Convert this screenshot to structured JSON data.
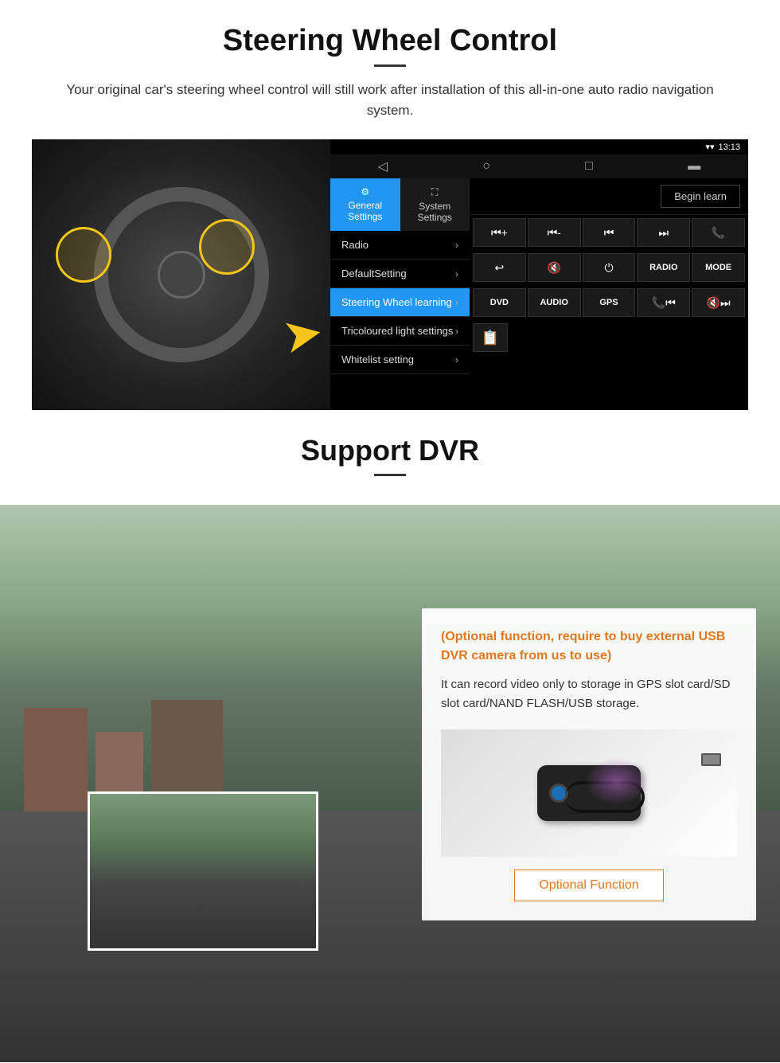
{
  "steering": {
    "title": "Steering Wheel Control",
    "subtitle": "Your original car's steering wheel control will still work after installation of this all-in-one auto radio navigation system.",
    "statusbar": {
      "time": "13:13",
      "signal_icon": "▾",
      "wifi_icon": "▾"
    },
    "tabs": [
      {
        "label": "General Settings",
        "icon": "⚙",
        "active": true
      },
      {
        "label": "System Settings",
        "icon": "🎮",
        "active": false
      }
    ],
    "menu": [
      {
        "label": "Radio",
        "active": false
      },
      {
        "label": "DefaultSetting",
        "active": false
      },
      {
        "label": "Steering Wheel learning",
        "active": true
      },
      {
        "label": "Tricoloured light settings",
        "active": false
      },
      {
        "label": "Whitelist setting",
        "active": false
      }
    ],
    "begin_learn_label": "Begin learn",
    "buttons_row1": [
      "⏮+",
      "⏮-",
      "⏮⏮",
      "⏭⏭",
      "📞"
    ],
    "buttons_row2": [
      "↩",
      "🔇",
      "⏻",
      "RADIO",
      "MODE"
    ],
    "buttons_row3": [
      "DVD",
      "AUDIO",
      "GPS",
      "📞⏮",
      "🔇⏭"
    ],
    "buttons_row4_icon": "📋"
  },
  "dvr": {
    "title": "Support DVR",
    "optional_note": "(Optional function, require to buy external USB DVR camera from us to use)",
    "description": "It can record video only to storage in GPS slot card/SD slot card/NAND FLASH/USB storage.",
    "optional_function_label": "Optional Function"
  }
}
